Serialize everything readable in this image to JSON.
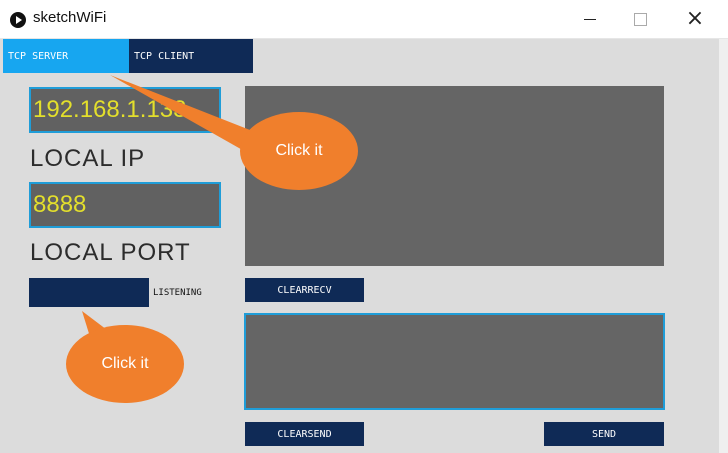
{
  "window": {
    "title": "sketchWiFi"
  },
  "tabs": [
    {
      "label": "TCP SERVER",
      "active": true
    },
    {
      "label": "TCP CLIENT",
      "active": false
    }
  ],
  "server": {
    "ip_value": "192.168.1.133",
    "ip_label": "LOCAL IP",
    "port_value": "8888",
    "port_label": "LOCAL PORT",
    "listening_label": "LISTENING"
  },
  "buttons": {
    "clear_recv": "CLEARRECV",
    "clear_send": "CLEARSEND",
    "send": "SEND"
  },
  "callouts": [
    {
      "text": "Click it"
    },
    {
      "text": "Click it"
    }
  ],
  "colors": {
    "accent": "#17a6f0",
    "dark_button": "#0f2a56",
    "text_highlight": "#e3df2c",
    "callout": "#f07f2c"
  }
}
